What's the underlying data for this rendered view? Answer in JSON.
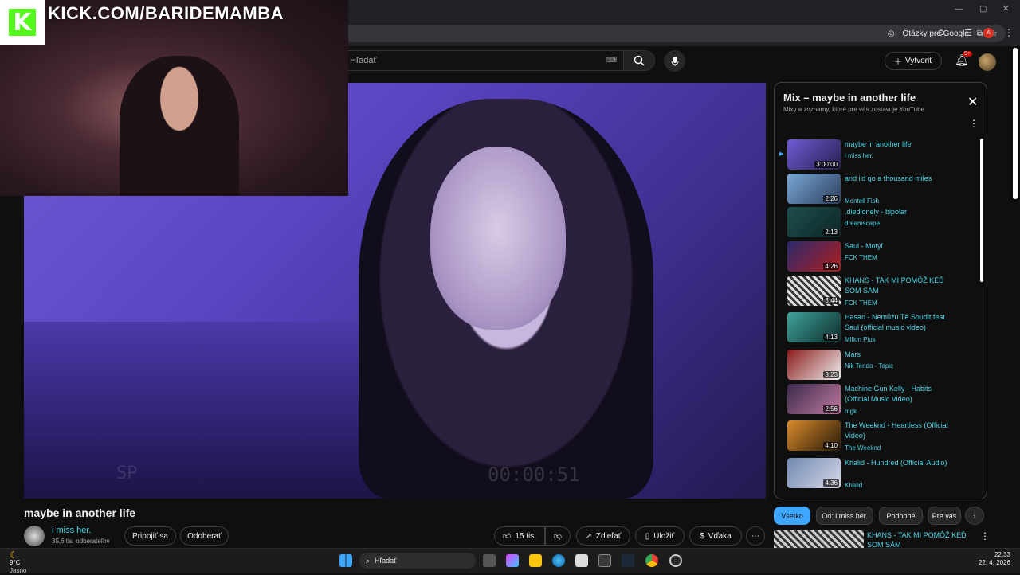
{
  "browser": {
    "ask_google": "Otázky pre Google",
    "profile_letter": "A"
  },
  "header": {
    "search_placeholder": "Hľadať",
    "create_label": "Vytvoriť",
    "notif_count": "9+"
  },
  "overlay": {
    "kick_url": "KICK.COM/BARIDEMAMBA"
  },
  "video": {
    "title": "maybe in another life",
    "watermark_left": "SP",
    "watermark_time": "00:00:51",
    "channel": {
      "name": "i miss her.",
      "subs": "35,6 tis. odberateľov",
      "join_label": "Pripojiť sa",
      "subscribe_label": "Odoberať"
    },
    "actions": {
      "likes": "15 tis.",
      "share": "Zdieľať",
      "save": "Uložiť",
      "thanks": "Vďaka"
    }
  },
  "playlist": {
    "title": "Mix – maybe in another life",
    "subtitle": "Mixy a zoznamy, ktoré pre vás zostavuje YouTube",
    "items": [
      {
        "title": "maybe in another life",
        "channel": "i miss her.",
        "duration": "3:00:00"
      },
      {
        "title": "and i'd go a thousand miles",
        "channel": "Montell Fish",
        "duration": "2:26"
      },
      {
        "title": ".diedlonely - bipolar",
        "channel": "dreamscape",
        "duration": "2:13"
      },
      {
        "title": "Saul - Motýľ",
        "channel": "FCK THEM",
        "duration": "4:26"
      },
      {
        "title": "KHANS - TAK MI POMÔŽ KEĎ SOM SÁM",
        "channel": "FCK THEM",
        "duration": "3:44"
      },
      {
        "title": "Hasan - Nemůžu Tě Soudit feat. Saul (official music video)",
        "channel": "Milion Plus",
        "duration": "4:13"
      },
      {
        "title": "Mars",
        "channel": "Nik Tendo - Topic",
        "duration": "3:23"
      },
      {
        "title": "Machine Gun Kelly - Habits (Official Music Video)",
        "channel": "mgk",
        "duration": "2:56"
      },
      {
        "title": "The Weeknd - Heartless (Official Video)",
        "channel": "The Weeknd",
        "duration": "4:10"
      },
      {
        "title": "Khalid - Hundred (Official Audio)",
        "channel": "Khalid",
        "duration": "4:36"
      }
    ]
  },
  "chips": [
    "Všetko",
    "Od: i miss her.",
    "Podobné",
    "Pre vás"
  ],
  "next_up": {
    "title": "KHANS - TAK MI POMÔŽ KEĎ SOM SÁM"
  },
  "taskbar": {
    "temp": "9°C",
    "weather": "Jasno",
    "search": "Hľadať",
    "time": "22:33",
    "date": "22. 4. 2026"
  },
  "colors": {
    "link": "#4fd6e8",
    "kick": "#53fc18",
    "accent": "#3ea6ff"
  }
}
